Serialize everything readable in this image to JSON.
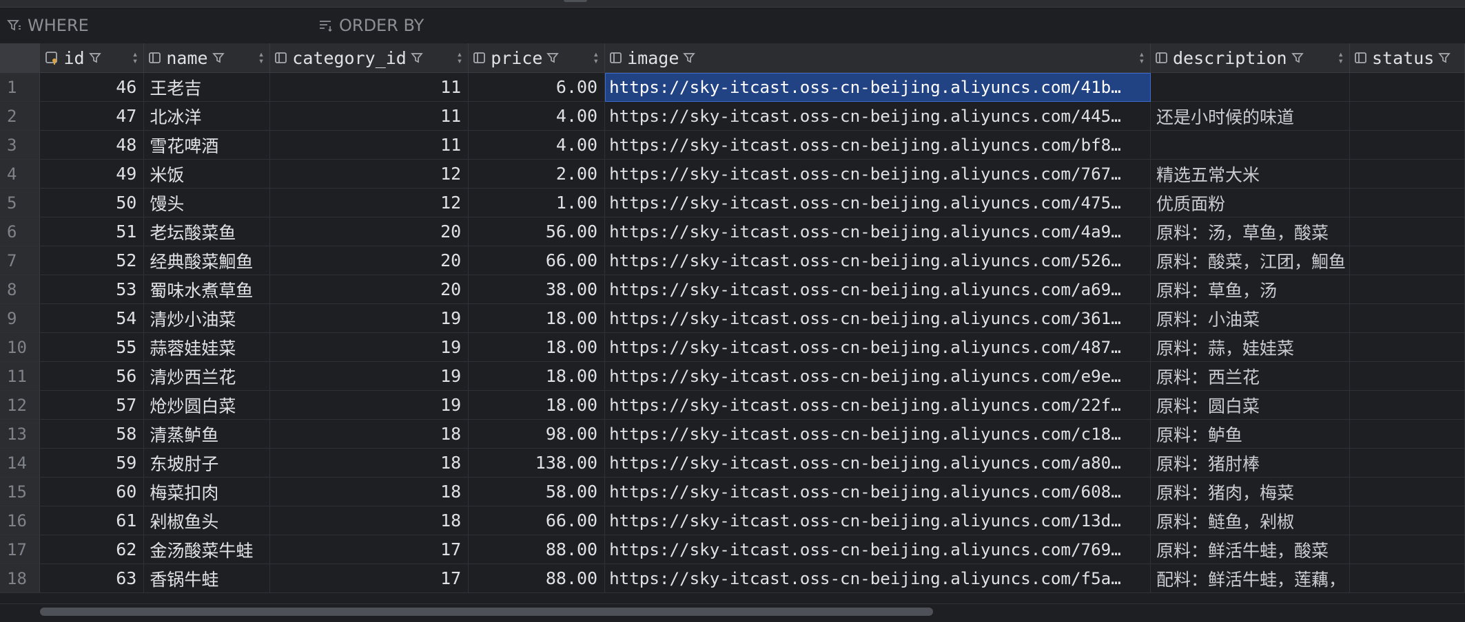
{
  "filter_bar": {
    "where_label": "WHERE",
    "order_by_label": "ORDER BY"
  },
  "columns": [
    {
      "key": "id",
      "label": "id"
    },
    {
      "key": "name",
      "label": "name"
    },
    {
      "key": "category_id",
      "label": "category_id"
    },
    {
      "key": "price",
      "label": "price"
    },
    {
      "key": "image",
      "label": "image"
    },
    {
      "key": "description",
      "label": "description"
    },
    {
      "key": "status",
      "label": "status"
    }
  ],
  "rows": [
    {
      "rn": "1",
      "id": "46",
      "name": "王老吉",
      "category_id": "11",
      "price": "6.00",
      "image": "https://sky-itcast.oss-cn-beijing.aliyuncs.com/41b…",
      "description": "",
      "status": ""
    },
    {
      "rn": "2",
      "id": "47",
      "name": "北冰洋",
      "category_id": "11",
      "price": "4.00",
      "image": "https://sky-itcast.oss-cn-beijing.aliyuncs.com/445…",
      "description": "还是小时候的味道",
      "status": ""
    },
    {
      "rn": "3",
      "id": "48",
      "name": "雪花啤酒",
      "category_id": "11",
      "price": "4.00",
      "image": "https://sky-itcast.oss-cn-beijing.aliyuncs.com/bf8…",
      "description": "",
      "status": ""
    },
    {
      "rn": "4",
      "id": "49",
      "name": "米饭",
      "category_id": "12",
      "price": "2.00",
      "image": "https://sky-itcast.oss-cn-beijing.aliyuncs.com/767…",
      "description": "精选五常大米",
      "status": ""
    },
    {
      "rn": "5",
      "id": "50",
      "name": "馒头",
      "category_id": "12",
      "price": "1.00",
      "image": "https://sky-itcast.oss-cn-beijing.aliyuncs.com/475…",
      "description": "优质面粉",
      "status": ""
    },
    {
      "rn": "6",
      "id": "51",
      "name": "老坛酸菜鱼",
      "category_id": "20",
      "price": "56.00",
      "image": "https://sky-itcast.oss-cn-beijing.aliyuncs.com/4a9…",
      "description": "原料：汤，草鱼，酸菜",
      "status": ""
    },
    {
      "rn": "7",
      "id": "52",
      "name": "经典酸菜鮰鱼",
      "category_id": "20",
      "price": "66.00",
      "image": "https://sky-itcast.oss-cn-beijing.aliyuncs.com/526…",
      "description": "原料：酸菜，江团，鮰鱼",
      "status": ""
    },
    {
      "rn": "8",
      "id": "53",
      "name": "蜀味水煮草鱼",
      "category_id": "20",
      "price": "38.00",
      "image": "https://sky-itcast.oss-cn-beijing.aliyuncs.com/a69…",
      "description": "原料：草鱼，汤",
      "status": ""
    },
    {
      "rn": "9",
      "id": "54",
      "name": "清炒小油菜",
      "category_id": "19",
      "price": "18.00",
      "image": "https://sky-itcast.oss-cn-beijing.aliyuncs.com/361…",
      "description": "原料：小油菜",
      "status": ""
    },
    {
      "rn": "10",
      "id": "55",
      "name": "蒜蓉娃娃菜",
      "category_id": "19",
      "price": "18.00",
      "image": "https://sky-itcast.oss-cn-beijing.aliyuncs.com/487…",
      "description": "原料：蒜，娃娃菜",
      "status": ""
    },
    {
      "rn": "11",
      "id": "56",
      "name": "清炒西兰花",
      "category_id": "19",
      "price": "18.00",
      "image": "https://sky-itcast.oss-cn-beijing.aliyuncs.com/e9e…",
      "description": "原料：西兰花",
      "status": ""
    },
    {
      "rn": "12",
      "id": "57",
      "name": "炝炒圆白菜",
      "category_id": "19",
      "price": "18.00",
      "image": "https://sky-itcast.oss-cn-beijing.aliyuncs.com/22f…",
      "description": "原料：圆白菜",
      "status": ""
    },
    {
      "rn": "13",
      "id": "58",
      "name": "清蒸鲈鱼",
      "category_id": "18",
      "price": "98.00",
      "image": "https://sky-itcast.oss-cn-beijing.aliyuncs.com/c18…",
      "description": "原料：鲈鱼",
      "status": ""
    },
    {
      "rn": "14",
      "id": "59",
      "name": "东坡肘子",
      "category_id": "18",
      "price": "138.00",
      "image": "https://sky-itcast.oss-cn-beijing.aliyuncs.com/a80…",
      "description": "原料：猪肘棒",
      "status": ""
    },
    {
      "rn": "15",
      "id": "60",
      "name": "梅菜扣肉",
      "category_id": "18",
      "price": "58.00",
      "image": "https://sky-itcast.oss-cn-beijing.aliyuncs.com/608…",
      "description": "原料：猪肉，梅菜",
      "status": ""
    },
    {
      "rn": "16",
      "id": "61",
      "name": "剁椒鱼头",
      "category_id": "18",
      "price": "66.00",
      "image": "https://sky-itcast.oss-cn-beijing.aliyuncs.com/13d…",
      "description": "原料：鲢鱼，剁椒",
      "status": ""
    },
    {
      "rn": "17",
      "id": "62",
      "name": "金汤酸菜牛蛙",
      "category_id": "17",
      "price": "88.00",
      "image": "https://sky-itcast.oss-cn-beijing.aliyuncs.com/769…",
      "description": "原料：鲜活牛蛙，酸菜",
      "status": ""
    },
    {
      "rn": "18",
      "id": "63",
      "name": "香锅牛蛙",
      "category_id": "17",
      "price": "88.00",
      "image": "https://sky-itcast.oss-cn-beijing.aliyuncs.com/f5a…",
      "description": "配料：鲜活牛蛙，莲藕，",
      "status": ""
    }
  ],
  "selected_cell": {
    "row": 1,
    "column": "image"
  },
  "colors": {
    "background": "#1e1f22",
    "header": "#2b2d30",
    "selection": "#214283",
    "text": "#dfe1e5",
    "muted": "#8c8f94"
  }
}
